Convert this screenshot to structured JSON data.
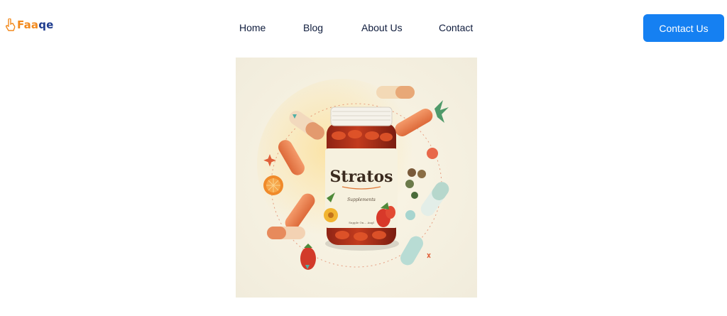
{
  "brand": {
    "logo_text_main": "Faa",
    "logo_text_accent": "qe",
    "logo_icon": "hand-pointer-icon"
  },
  "nav": {
    "items": [
      {
        "label": "Home"
      },
      {
        "label": "Blog"
      },
      {
        "label": "About Us"
      },
      {
        "label": "Contact"
      }
    ]
  },
  "cta": {
    "label": "Contact Us"
  },
  "hero_image": {
    "product_name": "Stratos",
    "product_subtitle": "Supplements",
    "product_small_print": "Supple On... Augl"
  },
  "colors": {
    "brand_orange": "#f28a1e",
    "brand_navy": "#1f3d8f",
    "cta_blue": "#1580f2",
    "nav_text": "#0f1c3d"
  }
}
